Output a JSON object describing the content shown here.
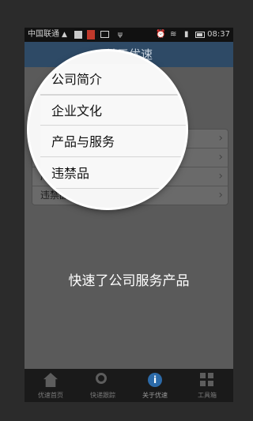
{
  "status_bar": {
    "carrier": "中国联通",
    "time": "08:37",
    "icons": [
      "warning-icon",
      "image-icon",
      "app-icon",
      "message-icon",
      "usb-icon",
      "alarm-icon",
      "wifi-icon",
      "signal-icon",
      "battery-icon"
    ]
  },
  "header": {
    "title": "关于优速"
  },
  "menu": {
    "items": [
      {
        "label": "公司简介"
      },
      {
        "label": "企业文化"
      },
      {
        "label": "产品与服务"
      },
      {
        "label": "违禁品"
      }
    ]
  },
  "tagline": "快速了公司服务产品",
  "tabbar": {
    "tabs": [
      {
        "label": "优速首页",
        "icon": "home-icon"
      },
      {
        "label": "快递跟踪",
        "icon": "search-icon"
      },
      {
        "label": "关于优速",
        "icon": "info-icon"
      },
      {
        "label": "工具箱",
        "icon": "grid-icon"
      }
    ]
  }
}
